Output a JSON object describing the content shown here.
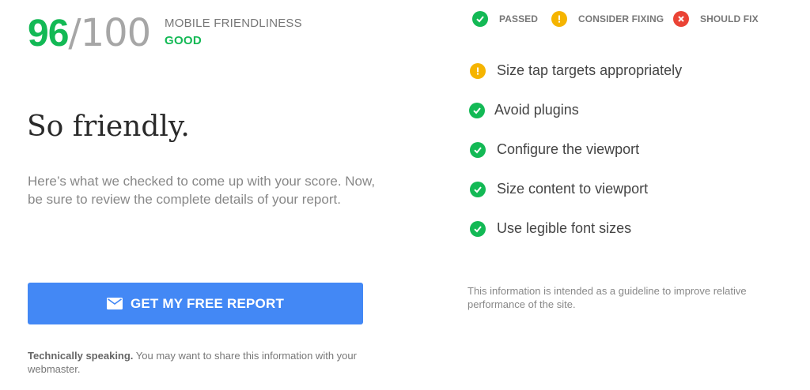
{
  "score": {
    "value": "96",
    "total": "/100"
  },
  "mobile_friendliness": {
    "label": "MOBILE FRIENDLINESS",
    "rating": "GOOD"
  },
  "headline": "So friendly.",
  "description": "Here’s what we checked to come up with your score. Now, be sure to review the complete details of your report.",
  "cta": {
    "label": "GET MY FREE REPORT",
    "icon": "mail-icon"
  },
  "technical": {
    "bold": "Technically speaking.",
    "text": " You may want to share this information with your webmaster."
  },
  "legend": [
    {
      "label": "PASSED",
      "status": "passed",
      "color": "#13b955"
    },
    {
      "label": "CONSIDER FIXING",
      "status": "consider",
      "color": "#f5b400"
    },
    {
      "label": "SHOULD FIX",
      "status": "fix",
      "color": "#ea4335"
    }
  ],
  "checks": [
    {
      "label": "Size tap targets appropriately",
      "status": "consider"
    },
    {
      "label": "Avoid plugins",
      "status": "passed"
    },
    {
      "label": "Configure the viewport",
      "status": "passed"
    },
    {
      "label": "Size content to viewport",
      "status": "passed"
    },
    {
      "label": "Use legible font sizes",
      "status": "passed"
    }
  ],
  "note": "This information is intended as a guideline to improve relative performance of the site."
}
